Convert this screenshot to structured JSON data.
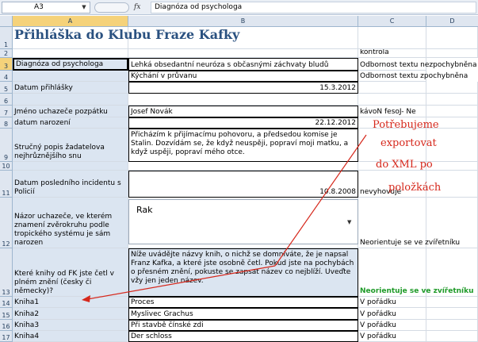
{
  "formula_bar": {
    "name_box": "A3",
    "fx_label": "fx",
    "formula": "Diagnóza od psychologa"
  },
  "columns": [
    {
      "letter": "A",
      "selected": true
    },
    {
      "letter": "B",
      "selected": false
    },
    {
      "letter": "C",
      "selected": false
    },
    {
      "letter": "D",
      "selected": false
    }
  ],
  "rows": {
    "r1": {
      "num": "1",
      "a": "Přihláška do Klubu Fraze Kafky"
    },
    "r2": {
      "num": "2",
      "c": "kontrola"
    },
    "r3": {
      "num": "3",
      "a": "Diagnóza od psychologa",
      "b": "Lehká obsedantní neuróza s občasnými záchvaty bludů",
      "c": "Odbornost textu nezpochybněna"
    },
    "r4": {
      "num": "4",
      "b": "Kýchání v průvanu",
      "c": "Odbornost textu zpochybněna"
    },
    "r5": {
      "num": "5",
      "a": "Datum přihlášky",
      "b": "15.3.2012"
    },
    "r6": {
      "num": "6"
    },
    "r7": {
      "num": "7",
      "a": "Jméno uchazeče pozpátku",
      "b": "Josef Novák",
      "c": "kávoN fesoJ- Ne"
    },
    "r8": {
      "num": "8",
      "a": "datum narození",
      "b": "22.12.2012"
    },
    "r9": {
      "num": "9",
      "a": "Stručný popis žadatelova nejhrůznějšího snu",
      "b": "Přicházím k přijímacímu pohovoru, a předsedou komise je Stalin. Dozvídám se, že když neuspěji, popraví moji matku, a když uspěji, popraví mého otce."
    },
    "r10": {
      "num": "10"
    },
    "r11": {
      "num": "11",
      "a": "Datum posledního incidentu s Policií",
      "b": "10.8.2008",
      "c": "nevyhovuje"
    },
    "r12": {
      "num": "12",
      "a": "Názor uchazeče, ve kterém znamení zvěrokruhu podle tropického systému je sám narozen",
      "c": "Neorientuje se ve zvířetníku"
    },
    "r13": {
      "num": "13",
      "a": "Které knihy od FK jste četl v plném znění (česky či německy)?",
      "b": "Níže uvádějte názvy knih, o nichž se domníváte, že je napsal Franz Kafka, a které jste osobně četl. Pokud jste na pochybách o přesném znění, pokuste se zapsat název co nejblíží. Uveďte vžy jen jeden název.",
      "c": "Neorientuje se ve zvířetníku"
    },
    "r14": {
      "num": "14",
      "a": "Kniha1",
      "b": "Proces",
      "c": "V pořádku"
    },
    "r15": {
      "num": "15",
      "a": "Kniha2",
      "b": "Myslivec Grachus",
      "c": "V pořádku"
    },
    "r16": {
      "num": "16",
      "a": "Kniha3",
      "b": "Při stavbě čínské zdi",
      "c": "V pořádku"
    },
    "r17": {
      "num": "17",
      "a": "Kniha4",
      "b": "Der schloss",
      "c": "V pořádku"
    }
  },
  "combo": {
    "value": "Rak"
  },
  "annotation": {
    "lines": [
      "Potřebujeme",
      "exportovat",
      "do XML po",
      "položkách"
    ],
    "color": "#d6281c"
  },
  "colors": {
    "header_bg": "#dfe6f0",
    "selected_header": "#f5d27a",
    "label_shade": "#dbe5f1",
    "title": "#2a5180",
    "ok_green": "#1e9a28"
  }
}
